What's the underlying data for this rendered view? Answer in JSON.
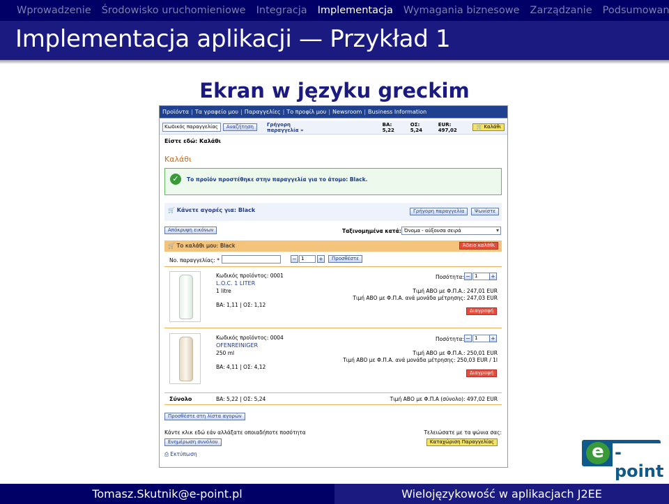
{
  "nav": {
    "items": [
      "Wprowadzenie",
      "Środowisko uruchomieniowe",
      "Integracja",
      "Implementacja",
      "Wymagania biznesowe",
      "Zarządzanie",
      "Podsumowanie"
    ],
    "active_index": 3
  },
  "slide": {
    "title": "Implementacja aplikacji — Przykład 1",
    "subtitle": "Ekran w języku greckim"
  },
  "app": {
    "topnav": [
      "Προϊόντα",
      "Τα γραφείο μου",
      "Παραγγελίες",
      "Το προφίλ μου",
      "Newsroom",
      "Business Information"
    ],
    "toolbar": {
      "search_value": "Κωδικός παραγγελίας",
      "search_button": "Αναζήτηση",
      "quick_order": "Γρήγορη παραγγελία »",
      "ba": "BA: 5,22",
      "os": "ΟΣ: 5,24",
      "eur": "EUR: 497,02",
      "cart_button": "Καλάθι"
    },
    "breadcrumb": "Είστε εδώ: Καλάθι",
    "heading": "Καλάθι",
    "success_msg": "Το προϊόν προστέθηκε στην παραγγελία για το άτομο: Black.",
    "shopping_for": "Κάνετε αγορές για: Black",
    "quick_order_btn": "Γρήγορη παραγγελία",
    "buy_btn": "Ψωνίστε",
    "hide_images_btn": "Απόκρυψη εικόνων",
    "sorted_label": "Ταξινομημένα κατά:",
    "sort_value": "Όνομα - αύξουσα σειρά",
    "cart_title": "Το καλάθι μου: Black",
    "delete_cart": "Άδειο καλάθι",
    "order_no_label": "Νο. παραγγελίας: *",
    "add_qty": "1",
    "add_btn": "Προσθέστε",
    "products": [
      {
        "code": "Κωδικός προϊόντος: 0001",
        "name": "L.O.C. 1 LITER",
        "size": "1 litre",
        "points": "BA: 1,11  |  ΟΣ: 1,12",
        "qty_label": "Ποσότητα:",
        "qty": "1",
        "price": "Τιμή ΑΒΟ με Φ.Π.Α.: 247,01 EUR",
        "unit_price": "Τιμή ΑΒΟ με Φ.Π.Α. ανά μονάδα μέτρησης: 247,03 EUR",
        "remove": "Διαγραφή"
      },
      {
        "code": "Κωδικός προϊόντος: 0004",
        "name": "OFENREINIGER",
        "size": "250 ml",
        "points": "BA: 4,11  |  ΟΣ: 4,12",
        "qty_label": "Ποσότητα:",
        "qty": "1",
        "price": "Τιμή ΑΒΟ με Φ.Π.Α.: 250,01 EUR",
        "unit_price": "Τιμή ΑΒΟ με Φ.Π.Α. ανά μονάδα μέτρησης: 250,03 EUR / 1l",
        "remove": "Διαγραφή"
      }
    ],
    "total_label": "Σύνολο",
    "total_points": "BA: 5,22  |  ΟΣ: 5,24",
    "total_price": "Τιμή ΑΒΟ με Φ.Π.Α (σύνολο): 497,02 EUR",
    "add_to_list": "Προσθέστε στη λίστα αγορών",
    "change_qty_text": "Κάντε κλικ εδώ εάν αλλάξατε οποιαδήποτε ποσότητα",
    "update_total": "Ενημέρωση συνόλου",
    "finished_text": "Τελειώσατε με τα ψώνια σας:",
    "submit_order": "Καταχώριση Παραγγελίας",
    "print": "Εκτύπωση"
  },
  "logo": {
    "e": "e",
    "rest": "-point"
  },
  "footer": {
    "left": "Tomasz.Skutnik@e-point.pl",
    "right": "Wielojęzykowość w aplikacjach J2EE"
  },
  "colors": {
    "nav_bg": "#000066",
    "title_bg": "#1a1a80",
    "app_nav": "#20418f",
    "success": "#5fb85f",
    "cart_head": "#f4c37c"
  }
}
